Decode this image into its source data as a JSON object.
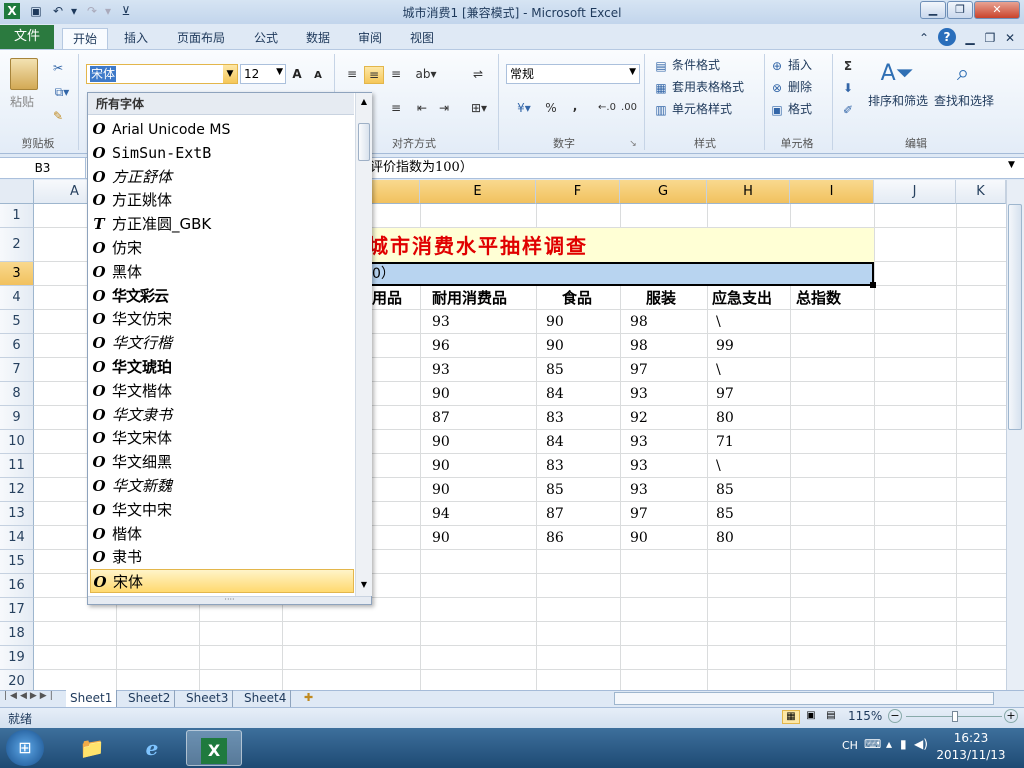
{
  "window": {
    "title": "城市消费1  [兼容模式] - Microsoft Excel"
  },
  "tabs": [
    "文件",
    "开始",
    "插入",
    "页面布局",
    "公式",
    "数据",
    "审阅",
    "视图"
  ],
  "ribbon": {
    "clipboard": {
      "paste": "粘贴",
      "label": "剪贴板"
    },
    "font": {
      "name": "宋体",
      "size": "12"
    },
    "alignment": {
      "label": "对齐方式"
    },
    "number": {
      "format": "常规",
      "label": "数字",
      "percent": "%",
      "comma": ","
    },
    "styles": {
      "conditional": "条件格式",
      "table": "套用表格格式",
      "cell": "单元格样式",
      "label": "样式"
    },
    "cells": {
      "insert": "插入",
      "delete": "删除",
      "format": "格式",
      "label": "单元格"
    },
    "editing": {
      "sort": "排序和筛选",
      "find": "查找和选择",
      "label": "编辑",
      "sigma": "Σ"
    }
  },
  "formula": {
    "namebox": "B3",
    "content": "评价指数为100）"
  },
  "columns": [
    "A",
    "E",
    "F",
    "G",
    "H",
    "I",
    "J",
    "K"
  ],
  "rows": [
    "1",
    "2",
    "3",
    "4",
    "5",
    "6",
    "7",
    "8",
    "9",
    "10",
    "11",
    "12",
    "13",
    "14",
    "15",
    "16",
    "17",
    "18",
    "19",
    "20"
  ],
  "sheet": {
    "title_fragment": "城市消费水平抽样调查",
    "row3_fragment": "0）",
    "headers": [
      "用品",
      "耐用消费品",
      "食品",
      "服装",
      "应急支出",
      "总指数"
    ],
    "data": [
      [
        "93",
        "90",
        "98",
        "\\"
      ],
      [
        "96",
        "90",
        "98",
        "99"
      ],
      [
        "93",
        "85",
        "97",
        "\\"
      ],
      [
        "90",
        "84",
        "93",
        "97"
      ],
      [
        "87",
        "83",
        "92",
        "80"
      ],
      [
        "90",
        "84",
        "93",
        "71"
      ],
      [
        "90",
        "83",
        "93",
        "\\"
      ],
      [
        "90",
        "85",
        "93",
        "85"
      ],
      [
        "94",
        "87",
        "97",
        "85"
      ],
      [
        "90",
        "86",
        "90",
        "80"
      ]
    ]
  },
  "font_dropdown": {
    "header": "所有字体",
    "items": [
      "Arial Unicode MS",
      "SimSun-ExtB",
      "方正舒体",
      "方正姚体",
      "方正准圆_GBK",
      "仿宋",
      "黑体",
      "华文彩云",
      "华文仿宋",
      "华文行楷",
      "华文琥珀",
      "华文楷体",
      "华文隶书",
      "华文宋体",
      "华文细黑",
      "华文新魏",
      "华文中宋",
      "楷体",
      "隶书",
      "宋体"
    ],
    "selected": "宋体"
  },
  "sheet_tabs": [
    "Sheet1",
    "Sheet2",
    "Sheet3",
    "Sheet4"
  ],
  "status": {
    "ready": "就绪",
    "zoom": "115%"
  },
  "taskbar": {
    "lang": "CH",
    "time": "16:23",
    "date": "2013/11/13"
  }
}
